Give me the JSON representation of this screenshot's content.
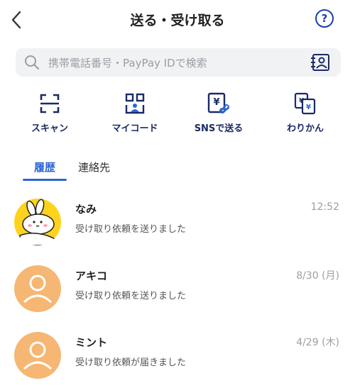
{
  "header": {
    "title": "送る・受け取る",
    "help_label": "?"
  },
  "search": {
    "placeholder": "携帯電話番号・PayPay IDで検索"
  },
  "actions": [
    {
      "label": "スキャン",
      "icon": "scan-icon"
    },
    {
      "label": "マイコード",
      "icon": "my-code-icon"
    },
    {
      "label": "SNSで送る",
      "icon": "sns-send-icon"
    },
    {
      "label": "わりかん",
      "icon": "split-bill-icon"
    }
  ],
  "tabs": {
    "active": "履歴",
    "inactive": "連絡先"
  },
  "history": [
    {
      "name": "なみ",
      "time": "12:52",
      "message": "受け取り依頼を送りました",
      "avatar": "bunny-avatar"
    },
    {
      "name": "アキコ",
      "time": "8/30 (月)",
      "message": "受け取り依頼を送りました",
      "avatar": "default-avatar"
    },
    {
      "name": "ミント",
      "time": "4/29 (木)",
      "message": "受け取り依頼が届きました",
      "avatar": "default-avatar"
    }
  ],
  "colors": {
    "accent": "#2c66d4",
    "icon_navy": "#1a2a66",
    "avatar_peach": "#f5b773",
    "avatar_yellow": "#ffd21e"
  }
}
